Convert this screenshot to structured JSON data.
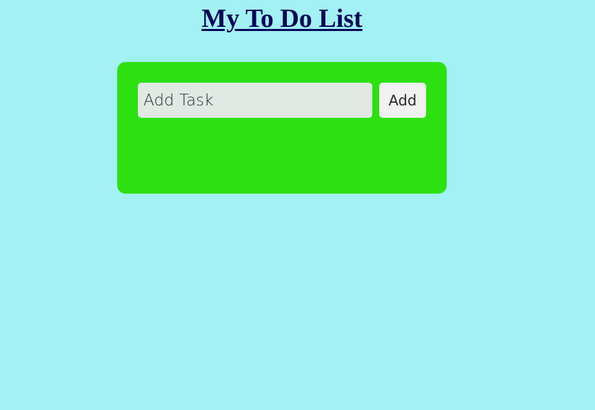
{
  "header": {
    "title": "My To Do List"
  },
  "todo": {
    "input_value": "",
    "input_placeholder": "Add Task",
    "add_label": "Add"
  },
  "colors": {
    "page_background": "#a2f1f4",
    "title": "#070657",
    "card_background": "#2de111",
    "input_background": "#e0e9e4",
    "button_background": "#f1f1f1"
  }
}
